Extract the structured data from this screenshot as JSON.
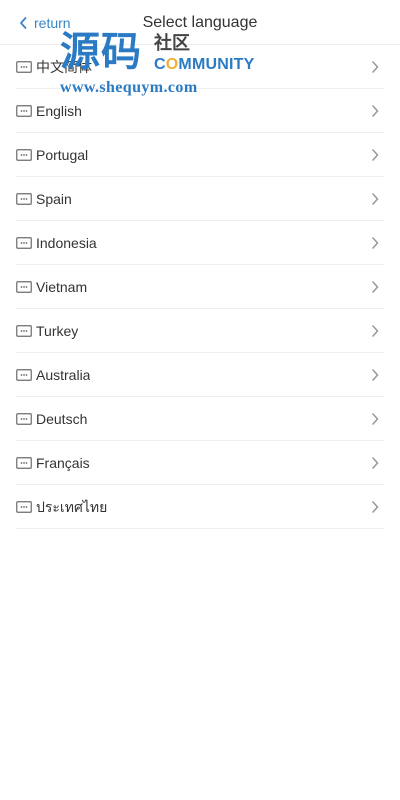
{
  "header": {
    "back_label": "return",
    "title": "Select language"
  },
  "languages": [
    {
      "label": "中文简体"
    },
    {
      "label": "English"
    },
    {
      "label": "Portugal"
    },
    {
      "label": "Spain"
    },
    {
      "label": "Indonesia"
    },
    {
      "label": "Vietnam"
    },
    {
      "label": "Turkey"
    },
    {
      "label": "Australia"
    },
    {
      "label": "Deutsch"
    },
    {
      "label": "Français"
    },
    {
      "label": "ประเทศไทย"
    }
  ],
  "watermark": {
    "cjk": "源码",
    "community_cjk": "社区",
    "community_prefix": "C",
    "community_o": "O",
    "community_suffix": "MMUNITY",
    "url": "www.shequym.com"
  },
  "icons": {
    "back": "chevron-left-icon",
    "language": "language-card-icon",
    "chevron": "chevron-right-icon"
  },
  "colors": {
    "accent": "#3a86c8",
    "text": "#333333",
    "divider": "#efefef",
    "icon": "#6b6b6b",
    "chevron": "#9a9a9a",
    "watermark_blue": "#2b7bc4",
    "watermark_gray": "#444444",
    "watermark_gold": "#f0b030"
  }
}
